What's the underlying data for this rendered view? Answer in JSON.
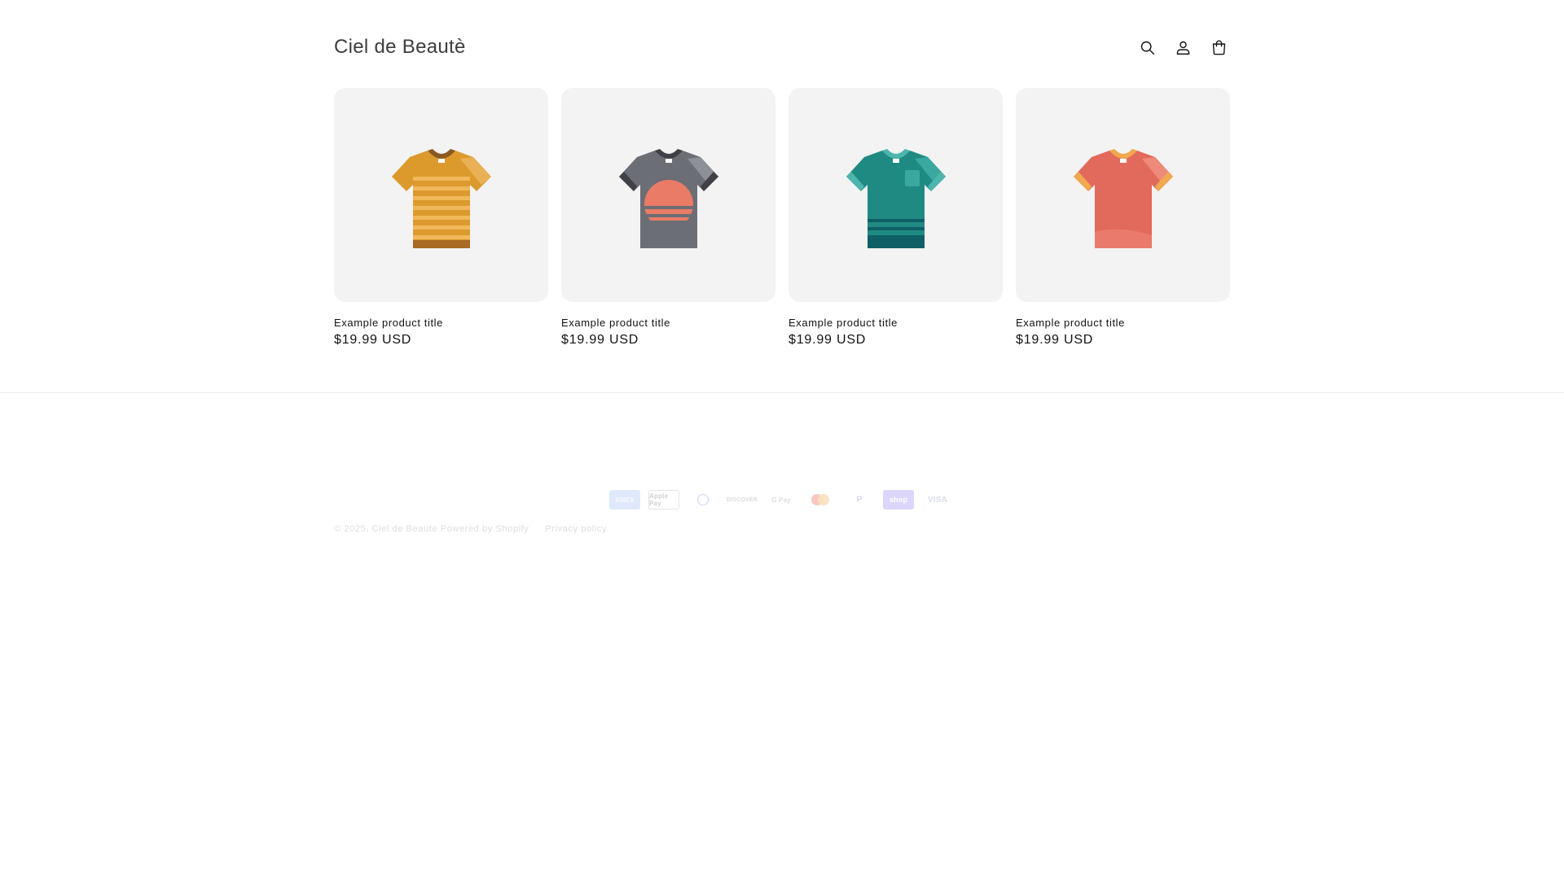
{
  "header": {
    "store_name": "Ciel de Beautè"
  },
  "products": [
    {
      "title": "Example product title",
      "price": "$19.99 USD",
      "image": "striped-orange-tshirt"
    },
    {
      "title": "Example product title",
      "price": "$19.99 USD",
      "image": "gray-sunset-tshirt"
    },
    {
      "title": "Example product title",
      "price": "$19.99 USD",
      "image": "teal-pocket-tshirt"
    },
    {
      "title": "Example product title",
      "price": "$19.99 USD",
      "image": "coral-ringer-tshirt"
    }
  ],
  "footer": {
    "payment_methods": [
      {
        "label": "AMEX",
        "name": "american-express-icon"
      },
      {
        "label": "Apple Pay",
        "name": "apple-pay-icon"
      },
      {
        "label": "Diners",
        "name": "diners-club-icon"
      },
      {
        "label": "DISCOVER",
        "name": "discover-icon"
      },
      {
        "label": "G Pay",
        "name": "google-pay-icon"
      },
      {
        "label": "",
        "name": "mastercard-icon"
      },
      {
        "label": "P",
        "name": "paypal-icon"
      },
      {
        "label": "shop",
        "name": "shop-pay-icon"
      },
      {
        "label": "VISA",
        "name": "visa-icon"
      }
    ],
    "copyright": "© 2025,",
    "store_link": "Ciel de Beautè",
    "powered_by": "Powered by Shopify",
    "privacy_policy": "Privacy policy"
  },
  "colors": {
    "text": "#121212",
    "card_background": "#f3f3f3",
    "footer_text_faded": "#dddddd"
  }
}
